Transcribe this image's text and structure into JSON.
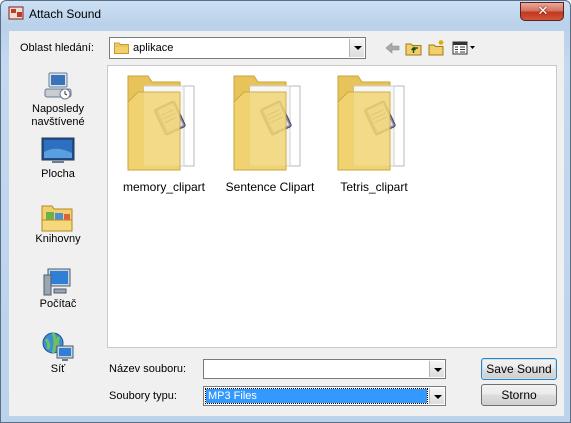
{
  "window": {
    "title": "Attach Sound",
    "close_icon": "close-icon"
  },
  "lookin": {
    "label": "Oblast hledání:",
    "value": "aplikace"
  },
  "toolbar": {
    "icons": [
      "back-arrow-icon",
      "up-folder-icon",
      "new-folder-icon",
      "view-menu-icon"
    ]
  },
  "places": [
    {
      "label_line1": "Naposledy",
      "label_line2": "navštívené",
      "icon": "recent-places-icon"
    },
    {
      "label_line1": "Plocha",
      "label_line2": "",
      "icon": "desktop-icon"
    },
    {
      "label_line1": "Knihovny",
      "label_line2": "",
      "icon": "libraries-icon"
    },
    {
      "label_line1": "Počítač",
      "label_line2": "",
      "icon": "computer-icon"
    },
    {
      "label_line1": "Síť",
      "label_line2": "",
      "icon": "network-icon"
    }
  ],
  "files": [
    {
      "name": "memory_clipart",
      "icon": "folder-icon"
    },
    {
      "name": "Sentence Clipart",
      "icon": "folder-icon"
    },
    {
      "name": "Tetris_clipart",
      "icon": "folder-icon"
    }
  ],
  "filename": {
    "label": "Název souboru:",
    "value": ""
  },
  "filetype": {
    "label": "Soubory typu:",
    "value": "MP3 Files"
  },
  "buttons": {
    "save": "Save Sound",
    "cancel": "Storno"
  }
}
